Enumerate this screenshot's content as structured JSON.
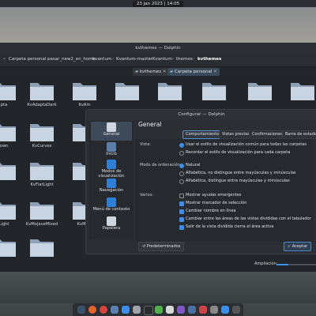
{
  "top_panel": {
    "clock": "23 Jan 2023 | 14:05"
  },
  "window": {
    "title": "kvthemes — Dolphin"
  },
  "breadcrumb": [
    "Carpeta personal",
    "pasar_new2_en_home",
    "kvantum",
    "Kvantum-master",
    "Kvantum",
    "themes",
    "kvthemes"
  ],
  "tabs": [
    {
      "label": "kvthemes"
    },
    {
      "label": "Carpeta personal"
    }
  ],
  "files": [
    {
      "name": "pta"
    },
    {
      "name": "KvAdaptaDark"
    },
    {
      "name": "KvAm"
    },
    {
      "name": ""
    },
    {
      "name": ""
    },
    {
      "name": ""
    },
    {
      "name": ""
    },
    {
      "name": "own"
    },
    {
      "name": "KvCurves"
    },
    {
      "name": ""
    },
    {
      "name": ""
    },
    {
      "name": "KvFlatLight"
    },
    {
      "name": ""
    },
    {
      "name": "Light"
    },
    {
      "name": "KvMojaveMixed"
    },
    {
      "name": "KvMoja"
    }
  ],
  "config": {
    "title": "Configurar — Dolphin",
    "section_title": "General",
    "pages": [
      {
        "label": "General",
        "icon": "general-icon"
      },
      {
        "label": "Inicio",
        "icon": "home-icon"
      },
      {
        "label": "Modos de visualización",
        "icon": "view-modes-icon"
      },
      {
        "label": "Navegación",
        "icon": "navigation-icon"
      },
      {
        "label": "Menú de contexto",
        "icon": "context-menu-icon"
      },
      {
        "label": "Papelera",
        "icon": "trash-icon"
      }
    ],
    "content_tabs": [
      "Comportamiento",
      "Vistas previas",
      "Confirmaciones",
      "Barra de estado"
    ],
    "groups": {
      "vista": {
        "label": "Vista:",
        "options": [
          "Usar el estilo de visualización común para todas las carpetas",
          "Recordar el estilo de visualización para cada carpeta"
        ]
      },
      "orden": {
        "label": "Modo de ordenación:",
        "options": [
          "Natural",
          "Alfabética, no distingue entre mayúsculas y minúsculas",
          "Alfabética, distingue entre mayúsculas y minúsculas"
        ]
      },
      "varios": {
        "label": "Varios:",
        "options": [
          "Mostrar ayudas emergentes",
          "Mostrar marcador de selección",
          "Cambiar nombre en línea",
          "Cambiar entre las áreas de las vistas divididas con el tabulador",
          "Salir de la vista dividida cierra el área activa"
        ]
      }
    },
    "buttons": {
      "defaults": "Predeterminados",
      "accept": "Aceptar"
    }
  },
  "status": {
    "zoom_label": "Ampliación:",
    "zoom_level": 0.3
  },
  "colors": {
    "accent": "#3d8ee8",
    "folder": "#c9d4e2"
  }
}
